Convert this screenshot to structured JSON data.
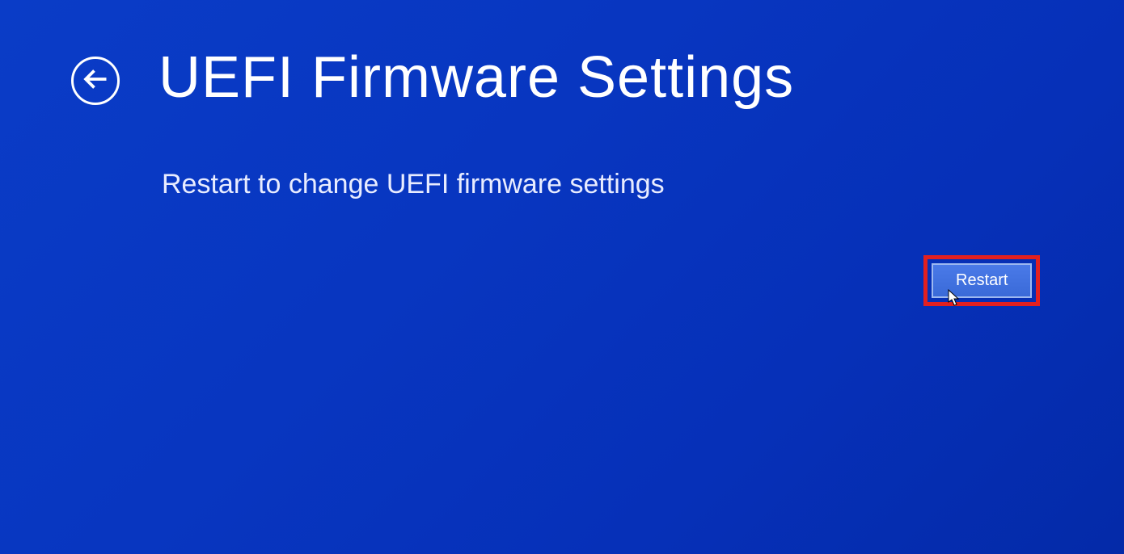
{
  "header": {
    "title": "UEFI Firmware Settings"
  },
  "main": {
    "description": "Restart to change UEFI firmware settings"
  },
  "actions": {
    "restart_label": "Restart"
  }
}
